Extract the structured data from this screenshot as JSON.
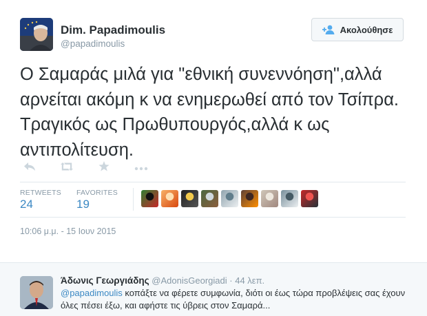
{
  "tweet": {
    "author_name": "Dim. Papadimoulis",
    "author_handle": "@papadimoulis",
    "follow_label": "Ακολούθησε",
    "text": "Ο Σαμαράς μιλά για \"εθνική συνεννόηση\",αλλά αρνείται ακόμη κ να ενημερωθεί από τον Τσίπρα. Τραγικός ως Πρωθυπουργός,αλλά κ ως αντιπολίτευση.",
    "actions": [
      "reply-icon",
      "retweet-icon",
      "favorite-icon",
      "more-icon"
    ],
    "stats": {
      "retweets_label": "RETWEETS",
      "retweets_value": "24",
      "favorites_label": "FAVORITES",
      "favorites_value": "19"
    },
    "favoriter_avatars": [
      {
        "name": "favoriter-avatar-1",
        "colors": [
          "#2e7d32",
          "#c62828",
          "#111111"
        ]
      },
      {
        "name": "favoriter-avatar-2",
        "colors": [
          "#f7b267",
          "#d9480f",
          "#ffe0b2"
        ]
      },
      {
        "name": "favoriter-avatar-3",
        "colors": [
          "#222222",
          "#555555",
          "#f2c94c"
        ]
      },
      {
        "name": "favoriter-avatar-4",
        "colors": [
          "#4a6741",
          "#8b5e3c",
          "#cfd8dc"
        ]
      },
      {
        "name": "favoriter-avatar-5",
        "colors": [
          "#90a4ae",
          "#eceff1",
          "#607d8b"
        ]
      },
      {
        "name": "favoriter-avatar-6",
        "colors": [
          "#5d4037",
          "#ff8f00",
          "#3e2723"
        ]
      },
      {
        "name": "favoriter-avatar-7",
        "colors": [
          "#cfc6b8",
          "#a1887f",
          "#eee8de"
        ]
      },
      {
        "name": "favoriter-avatar-8",
        "colors": [
          "#78909c",
          "#eceff1",
          "#455a64"
        ]
      },
      {
        "name": "favoriter-avatar-9",
        "colors": [
          "#c62828",
          "#263238",
          "#ef5350"
        ]
      }
    ],
    "timestamp": "10:06 μ.μ. - 15 Ιουν 2015"
  },
  "reply": {
    "author_name": "Άδωνις Γεωργιάδης",
    "author_handle": "@AdonisGeorgiadi",
    "separator": "·",
    "time": "44 λεπ.",
    "mention": "@papadimoulis",
    "text": " κοπάξτε να φέρετε συμφωνία, διότι οι έως τώρα προβλέψεις σας έχουν όλες πέσει έξω, και αφήστε τις ύβρεις στον Σαμαρά..."
  },
  "colors": {
    "link": "#3b88c3",
    "muted": "#8899a6",
    "text": "#292f33",
    "divider": "#e1e8ed"
  }
}
